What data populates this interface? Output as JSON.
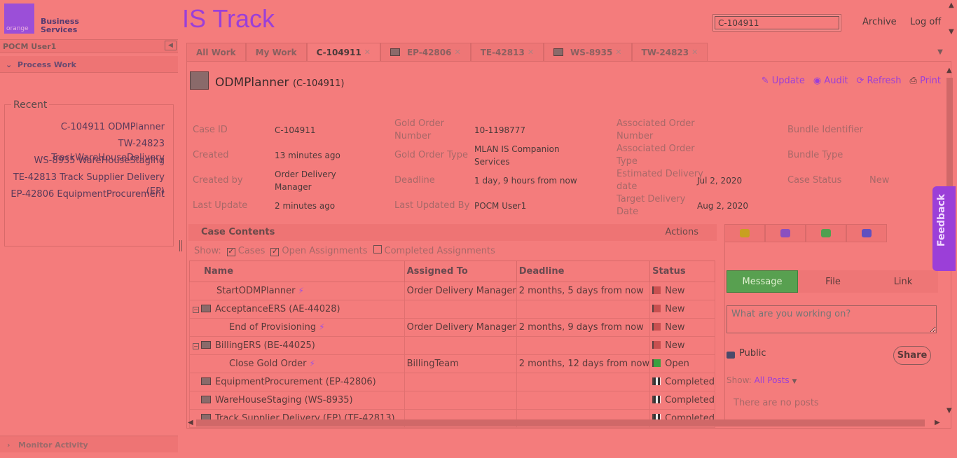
{
  "header": {
    "logo_mark": "orange",
    "logo_text_line1": "Business",
    "logo_text_line2": "Services",
    "app_title": "IS Track",
    "search_value": "C-104911",
    "archive_link": "Archive",
    "logoff_link": "Log off"
  },
  "sidebar": {
    "user_name": "POCM User1",
    "process_work_label": "Process Work",
    "recent_label": "Recent",
    "recent_items": [
      "C-104911 ODMPlanner",
      "TW-24823 TrackWareHouseDelivery",
      "WS-8935 WareHouseStaging",
      "TE-42813 Track Supplier Delivery (EP)",
      "EP-42806 EquipmentProcurement"
    ],
    "monitor_label": "Monitor Activity"
  },
  "tabs": [
    {
      "label": "All Work"
    },
    {
      "label": "My Work"
    },
    {
      "label": "C-104911"
    },
    {
      "label": "EP-42806"
    },
    {
      "label": "TE-42813"
    },
    {
      "label": "WS-8935"
    },
    {
      "label": "TW-24823"
    }
  ],
  "case": {
    "title": "ODMPlanner",
    "id_paren": "(C-104911)",
    "actions": {
      "update": "Update",
      "audit": "Audit",
      "refresh": "Refresh",
      "print": "Print"
    },
    "fields": {
      "case_id_label": "Case ID",
      "case_id": "C-104911",
      "created_label": "Created",
      "created": "13 minutes ago",
      "created_by_label": "Created by",
      "created_by_1": "Order Delivery",
      "created_by_2": "Manager",
      "last_update_label": "Last Update",
      "last_update": "2 minutes ago",
      "gold_order_number_label_1": "Gold Order",
      "gold_order_number_label_2": "Number",
      "gold_order_number": "10-1198777",
      "gold_order_type_label": "Gold Order Type",
      "gold_order_type_1": "MLAN IS Companion",
      "gold_order_type_2": "Services",
      "deadline_label": "Deadline",
      "deadline": "1 day, 9 hours from now",
      "last_updated_by_label": "Last Updated By",
      "last_updated_by": "POCM User1",
      "assoc_order_number_label_1": "Associated Order",
      "assoc_order_number_label_2": "Number",
      "assoc_order_type_label_1": "Associated Order",
      "assoc_order_type_label_2": "Type",
      "est_delivery_label_1": "Estimated Delivery",
      "est_delivery_label_2": "date",
      "est_delivery": "Jul 2, 2020",
      "target_delivery_label_1": "Target Delivery",
      "target_delivery_label_2": "Date",
      "target_delivery": "Aug 2, 2020",
      "bundle_identifier_label": "Bundle Identifier",
      "bundle_type_label": "Bundle Type",
      "case_status_label": "Case Status",
      "case_status": "New"
    }
  },
  "contents": {
    "header": "Case Contents",
    "actions": "Actions",
    "show_label": "Show:",
    "filter_cases": "Cases",
    "filter_open": "Open Assignments",
    "filter_completed": "Completed Assignments",
    "columns": [
      "Name",
      "Assigned To",
      "Deadline",
      "Status"
    ],
    "rows": [
      {
        "name": "StartODMPlanner",
        "assigned": "Order Delivery Manager",
        "deadline": "2 months, 5 days from now",
        "status": "New"
      },
      {
        "name": "AcceptanceERS (AE-44028)",
        "assigned": "",
        "deadline": "",
        "status": "New"
      },
      {
        "name": "End of Provisioning",
        "assigned": "Order Delivery Manager",
        "deadline": "2 months, 9 days from now",
        "status": "New"
      },
      {
        "name": "BillingERS (BE-44025)",
        "assigned": "",
        "deadline": "",
        "status": "New"
      },
      {
        "name": "Close Gold Order",
        "assigned": "BillingTeam",
        "deadline": "2 months, 12 days from now",
        "status": "Open"
      },
      {
        "name": "EquipmentProcurement (EP-42806)",
        "assigned": "",
        "deadline": "",
        "status": "Completed"
      },
      {
        "name": "WareHouseStaging (WS-8935)",
        "assigned": "",
        "deadline": "",
        "status": "Completed"
      },
      {
        "name": "Track Supplier Delivery (EP) (TE-42813)",
        "assigned": "",
        "deadline": "",
        "status": "Completed"
      }
    ]
  },
  "pulse": {
    "seg_message": "Message",
    "seg_file": "File",
    "seg_link": "Link",
    "placeholder": "What are you working on?",
    "public": "Public",
    "share": "Share",
    "show_label": "Show:",
    "show_value": "All Posts",
    "no_posts": "There are no posts"
  },
  "feedback": "Feedback"
}
